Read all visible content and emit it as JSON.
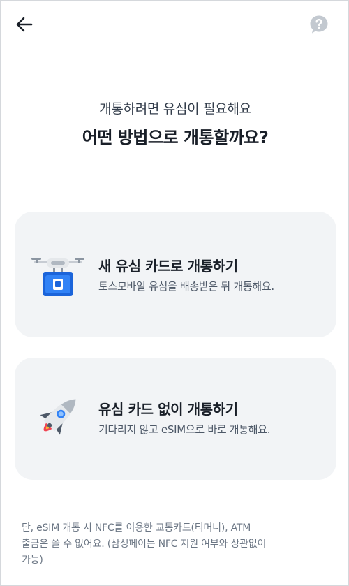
{
  "header": {
    "back_icon": "arrow-left-icon",
    "help_icon": "question-bubble-icon"
  },
  "intro": {
    "subtitle": "개통하려면 유심이 필요해요",
    "title": "어떤 방법으로 개통할까요?"
  },
  "options": [
    {
      "icon": "drone-delivery-icon",
      "title": "새 유심 카드로 개통하기",
      "description": "토스모바일 유심을 배송받은 뒤 개통해요."
    },
    {
      "icon": "rocket-icon",
      "title": "유심 카드 없이 개통하기",
      "description": "기다리지 않고 eSIM으로 바로 개통해요."
    }
  ],
  "footnote": {
    "lines": [
      "단, eSIM 개통 시 NFC를 이용한 교통카드(티머니), ATM",
      "출금은 쓸 수 없어요. (삼성페이는 NFC 지원 여부와 상관없이",
      "가능)"
    ]
  },
  "colors": {
    "background": "#ffffff",
    "card_background": "#f2f4f6",
    "title_text": "#191f28",
    "body_text": "#4e5968",
    "footnote_text": "#6b7684",
    "accent_blue": "#3182f6"
  }
}
